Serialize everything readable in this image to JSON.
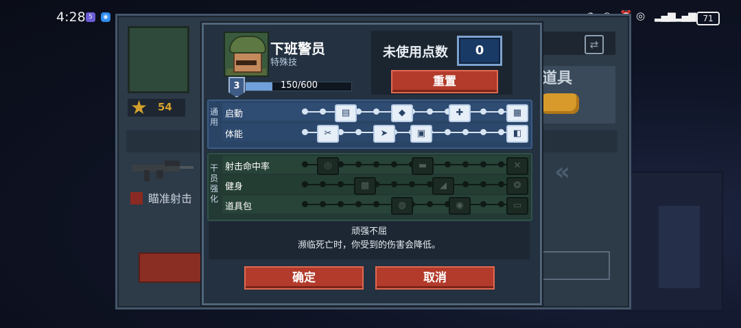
{
  "status_bar": {
    "time": "4:28",
    "battery": "71"
  },
  "background": {
    "stars_value": "54",
    "aim_label": "瞄准射击",
    "items_label": "道具"
  },
  "hero": {
    "name": "下班警员",
    "subtitle": "特殊技",
    "level": "3",
    "xp_text": "150/600",
    "xp_fraction": 0.25
  },
  "points": {
    "label": "未使用点数",
    "value": "0",
    "reset_label": "重置"
  },
  "skill_groups": [
    {
      "tab": "通用",
      "rows": [
        {
          "label": "启動",
          "icons": [
            "ammo-belt-icon",
            "shield-plus-icon",
            "medkit-icon",
            "supply-crate-icon"
          ]
        },
        {
          "label": "体能",
          "icons": [
            "knife-icon",
            "sprint-icon",
            "armor-plate-icon",
            "backpack-icon"
          ]
        }
      ]
    },
    {
      "tab": "干员强化",
      "rows": [
        {
          "label": "射击命中率",
          "icons": [
            "fingerprint-icon",
            "rifle-scope-icon",
            "crossed-guns-icon"
          ]
        },
        {
          "label": "健身",
          "icons": [
            "fist-icon",
            "boot-kick-icon",
            "tough-skin-icon"
          ]
        },
        {
          "label": "道具包",
          "icons": [
            "grenade-icon",
            "gas-mask-icon",
            "ammo-pouch-icon"
          ]
        }
      ]
    }
  ],
  "description": {
    "title": "顽强不屈",
    "text": "濒临死亡时，你受到的伤害会降低。"
  },
  "buttons": {
    "confirm": "确定",
    "cancel": "取消"
  },
  "colors": {
    "accent_red": "#b33b2b",
    "general_group": "#2a4466",
    "cadre_group": "#223a33",
    "xp_fill": "#6fa0d9"
  }
}
